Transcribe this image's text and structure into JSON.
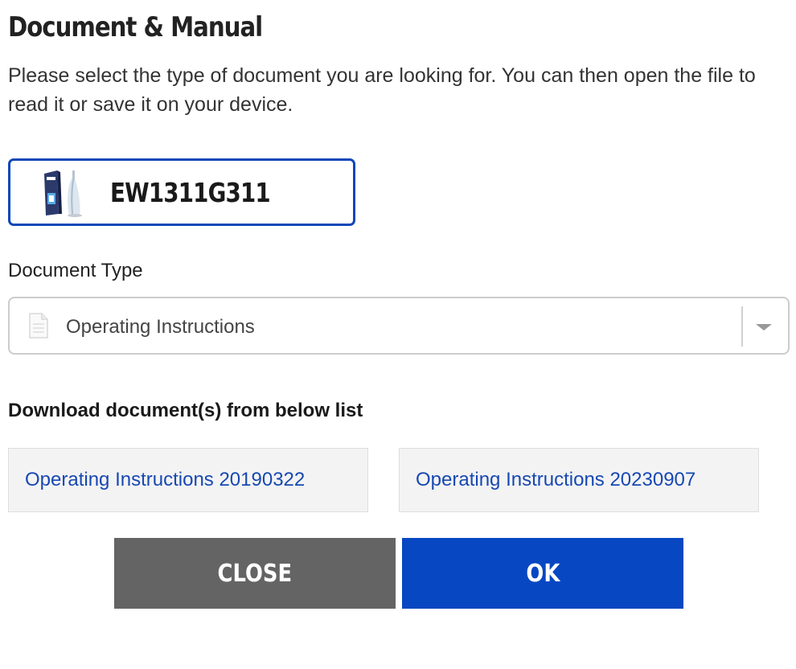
{
  "dialog": {
    "title": "Document & Manual",
    "intro": "Please select the type of document you are looking for. You can then open the file to read it or save it on your device."
  },
  "product": {
    "model": "EW1311G311",
    "image_icon": "product-box-icon"
  },
  "document_type": {
    "label": "Document Type",
    "selected": "Operating Instructions",
    "icon": "document-icon"
  },
  "downloads": {
    "heading": "Download document(s) from below list",
    "items": [
      {
        "label": "Operating Instructions 20190322"
      },
      {
        "label": "Operating Instructions 20230907"
      }
    ]
  },
  "buttons": {
    "close_label": "CLOSE",
    "ok_label": "OK"
  },
  "colors": {
    "accent": "#0747c2",
    "link": "#1748b3",
    "close_button": "#646464"
  }
}
